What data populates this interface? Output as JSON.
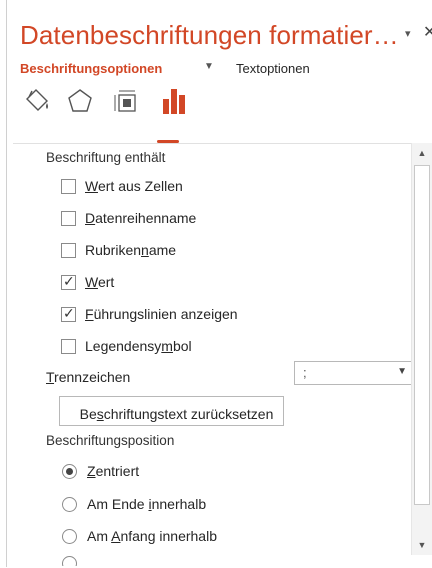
{
  "pane": {
    "title": "Datenbeschriftungen formatier…",
    "pin_glyph": "▾",
    "close_glyph": "✕"
  },
  "tabs": {
    "label_options": "Beschriftungsoptionen",
    "label_options_caret": "▼",
    "text_options": "Textoptionen"
  },
  "category_icons": [
    "fill-line-icon",
    "effects-icon",
    "size-properties-icon",
    "label-options-icon"
  ],
  "label_contains": {
    "header": "Beschriftung enthält",
    "items": [
      {
        "pre": "",
        "key": "W",
        "post": "ert aus Zellen",
        "checked": false
      },
      {
        "pre": "",
        "key": "D",
        "post": "atenreihenname",
        "checked": false
      },
      {
        "pre": "Rubriken",
        "key": "n",
        "post": "ame",
        "checked": false
      },
      {
        "pre": "",
        "key": "W",
        "post": "ert",
        "checked": true
      },
      {
        "pre": "",
        "key": "F",
        "post": "ührungslinien anzeigen",
        "checked": true
      },
      {
        "pre": "Legendensy",
        "key": "m",
        "post": "bol",
        "checked": false
      }
    ],
    "check_glyph": "✓"
  },
  "separator": {
    "label_key": "T",
    "label_rest": "rennzeichen",
    "value": ";",
    "arrow": "▼"
  },
  "reset_button": {
    "pre": "Be",
    "key": "s",
    "post": "chriftungstext zurücksetzen"
  },
  "label_position": {
    "header": "Beschriftungsposition",
    "items": [
      {
        "pre": "",
        "key": "Z",
        "post": "entriert",
        "selected": true
      },
      {
        "pre": "Am Ende ",
        "key": "i",
        "post": "nnerhalb",
        "selected": false
      },
      {
        "pre": "Am ",
        "key": "A",
        "post": "nfang innerhalb",
        "selected": false
      }
    ]
  },
  "scrollbar": {
    "up": "▲",
    "down": "▼"
  },
  "colors": {
    "accent": "#d24726",
    "icon_orange": "#d24726",
    "text": "#262626"
  }
}
